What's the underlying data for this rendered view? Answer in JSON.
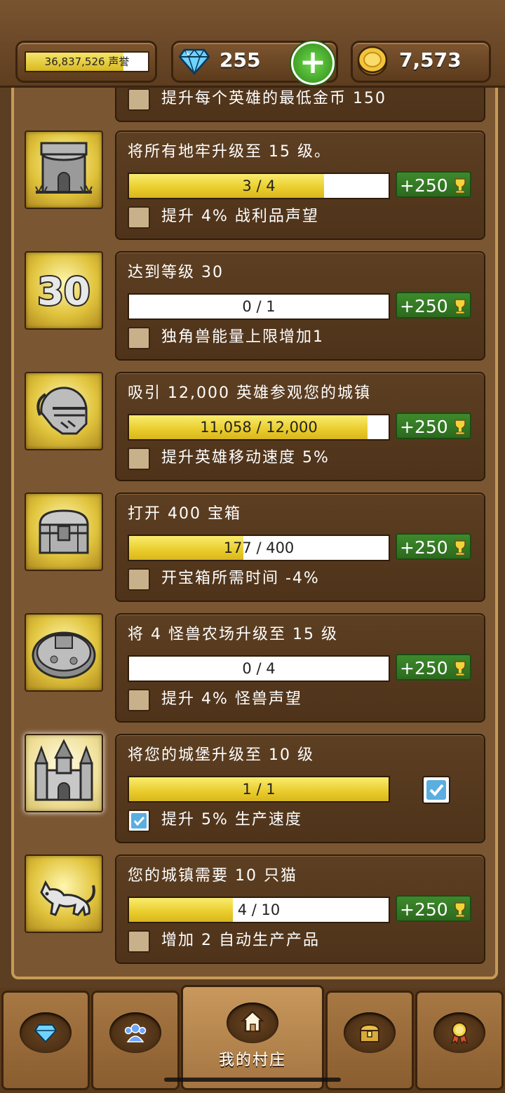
{
  "header": {
    "fame_text": "36,837,526 声誉",
    "fame_fill_fraction": 0.8,
    "gems": "255",
    "gold": "7,573"
  },
  "partial_item": {
    "bonus": "提升每个英雄的最低金币 150"
  },
  "achievements": [
    {
      "title": "将所有地牢升级至 15 级。",
      "progress": "3 / 4",
      "fraction": 0.75,
      "reward": "+250",
      "bonus": "提升 4% 战利品声望",
      "claimed": false,
      "icon": "dungeon-tower-icon"
    },
    {
      "title": "达到等级 30",
      "progress": "0 / 1",
      "fraction": 0,
      "reward": "+250",
      "bonus": "独角兽能量上限增加1",
      "claimed": false,
      "icon": "level-30-icon"
    },
    {
      "title": "吸引 12,000 英雄参观您的城镇",
      "progress": "11,058 / 12,000",
      "fraction": 0.92,
      "reward": "+250",
      "bonus": "提升英雄移动速度 5%",
      "claimed": false,
      "icon": "knight-helmet-icon"
    },
    {
      "title": "打开 400 宝箱",
      "progress": "177 / 400",
      "fraction": 0.44,
      "reward": "+250",
      "bonus": "开宝箱所需时间 -4%",
      "claimed": false,
      "icon": "treasure-chest-icon"
    },
    {
      "title": "将 4 怪兽农场升级至 15 级",
      "progress": "0 / 4",
      "fraction": 0,
      "reward": "+250",
      "bonus": "提升 4% 怪兽声望",
      "claimed": false,
      "icon": "monster-farm-icon"
    },
    {
      "title": "将您的城堡升级至 10 级",
      "progress": "1 / 1",
      "fraction": 1,
      "reward": "",
      "bonus": "提升 5% 生产速度",
      "claimed": true,
      "icon": "castle-icon"
    },
    {
      "title": "您的城镇需要 10 只猫",
      "progress": "4 / 10",
      "fraction": 0.4,
      "reward": "+250",
      "bonus": "增加 2 自动生产产品",
      "claimed": false,
      "icon": "cat-icon"
    }
  ],
  "nav": {
    "tabs": [
      {
        "icon": "gem-tab-icon",
        "label": ""
      },
      {
        "icon": "heroes-tab-icon",
        "label": ""
      },
      {
        "icon": "house-tab-icon",
        "label": "我的村庄",
        "active": true
      },
      {
        "icon": "chest-tab-icon",
        "label": ""
      },
      {
        "icon": "medal-tab-icon",
        "label": ""
      }
    ]
  },
  "colors": {
    "progress_yellow": "#e9cc2c",
    "reward_green": "#2c6a1e",
    "panel_brown": "#4e331a"
  }
}
